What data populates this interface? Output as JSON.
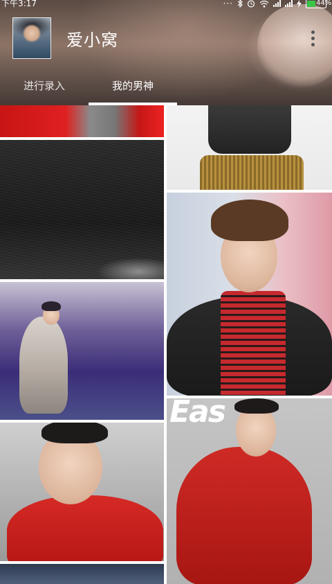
{
  "status_bar": {
    "time": "下午3:17",
    "battery_percent": "44%",
    "battery_level": 0.44,
    "icons": [
      "more-dots-icon",
      "bluetooth-icon",
      "alarm-icon",
      "wifi-icon",
      "signal-icon",
      "signal-icon",
      "charging-icon",
      "battery-icon"
    ]
  },
  "header": {
    "username": "爱小窝"
  },
  "tabs": [
    {
      "label": "进行录入",
      "selected": false
    },
    {
      "label": "我的男神",
      "selected": true
    }
  ],
  "gallery": {
    "columns": 2,
    "left_column": [
      "photo-red-jacket",
      "photo-dark-backdrop",
      "photo-theater-seats",
      "photo-red-shirt-portrait",
      "photo-partial"
    ],
    "right_column": [
      "photo-striped-pants",
      "photo-plaid-shirt-portrait",
      "photo-magazine-red-shirt"
    ],
    "magazine_text": "Eas"
  },
  "colors": {
    "tab_indicator": "#ffffff",
    "battery_fill": "#39c548",
    "text_on_header": "#ffffff"
  }
}
